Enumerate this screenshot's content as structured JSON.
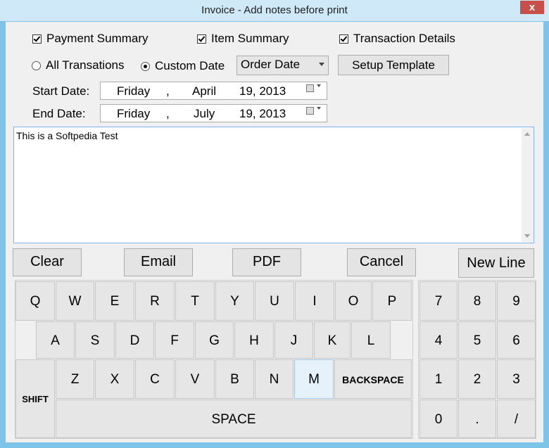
{
  "window": {
    "title": "Invoice - Add notes before print",
    "close": "x"
  },
  "options": {
    "payment_summary": "Payment Summary",
    "item_summary": "Item Summary",
    "transaction_details": "Transaction Details",
    "all_transactions": "All Transations",
    "custom_date": "Custom Date",
    "date_type": "Order Date",
    "setup_template": "Setup Template"
  },
  "dates": {
    "start_label": "Start Date:",
    "end_label": "End Date:",
    "start": {
      "day": "Friday",
      "sep": ",",
      "month": "April",
      "date": "19, 2013"
    },
    "end": {
      "day": "Friday",
      "sep": ",",
      "month": "July",
      "date": "19, 2013"
    }
  },
  "notes": {
    "value": "This is a Softpedia Test"
  },
  "actions": {
    "clear": "Clear",
    "email": "Email",
    "pdf": "PDF",
    "cancel": "Cancel",
    "new_line": "New Line"
  },
  "keyboard": {
    "row1": [
      "Q",
      "W",
      "E",
      "R",
      "T",
      "Y",
      "U",
      "I",
      "O",
      "P"
    ],
    "row2": [
      "A",
      "S",
      "D",
      "F",
      "G",
      "H",
      "J",
      "K",
      "L"
    ],
    "row3": [
      "Z",
      "X",
      "C",
      "V",
      "B",
      "N",
      "M"
    ],
    "shift": "SHIFT",
    "backspace": "BACKSPACE",
    "space": "SPACE",
    "numpad": [
      "7",
      "8",
      "9",
      "4",
      "5",
      "6",
      "1",
      "2",
      "3",
      "0",
      ".",
      "/"
    ]
  }
}
